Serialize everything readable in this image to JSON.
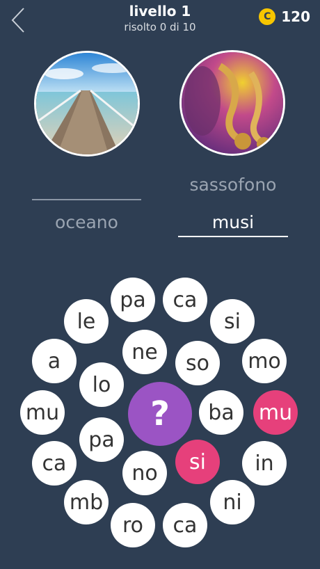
{
  "header": {
    "title": "livello 1",
    "subtitle": "risolto 0 di 10",
    "coins": "120",
    "coin_symbol": "C"
  },
  "images": {
    "left": "pier-photo",
    "right": "saxophone-photo"
  },
  "words": {
    "left_solved": "",
    "left_hint": "oceano",
    "right_solved": "sassofono",
    "right_current": "musi"
  },
  "hint_symbol": "?",
  "colors": {
    "background": "#2e3e53",
    "bubble": "#ffffff",
    "selected": "#e6407b",
    "hint": "#9b54c4",
    "coin": "#f7c600"
  },
  "bubbles": [
    {
      "text": "pa",
      "state": "normal"
    },
    {
      "text": "ca",
      "state": "normal"
    },
    {
      "text": "le",
      "state": "normal"
    },
    {
      "text": "si",
      "state": "normal"
    },
    {
      "text": "ne",
      "state": "normal"
    },
    {
      "text": "a",
      "state": "normal"
    },
    {
      "text": "so",
      "state": "normal"
    },
    {
      "text": "mo",
      "state": "normal"
    },
    {
      "text": "lo",
      "state": "normal"
    },
    {
      "text": "mu",
      "state": "normal"
    },
    {
      "text": "ba",
      "state": "normal"
    },
    {
      "text": "mu",
      "state": "selected"
    },
    {
      "text": "pa",
      "state": "normal"
    },
    {
      "text": "ca",
      "state": "normal"
    },
    {
      "text": "si",
      "state": "selected"
    },
    {
      "text": "in",
      "state": "normal"
    },
    {
      "text": "no",
      "state": "normal"
    },
    {
      "text": "ni",
      "state": "normal"
    },
    {
      "text": "mb",
      "state": "normal"
    },
    {
      "text": "ro",
      "state": "normal"
    },
    {
      "text": "ca",
      "state": "normal"
    }
  ]
}
